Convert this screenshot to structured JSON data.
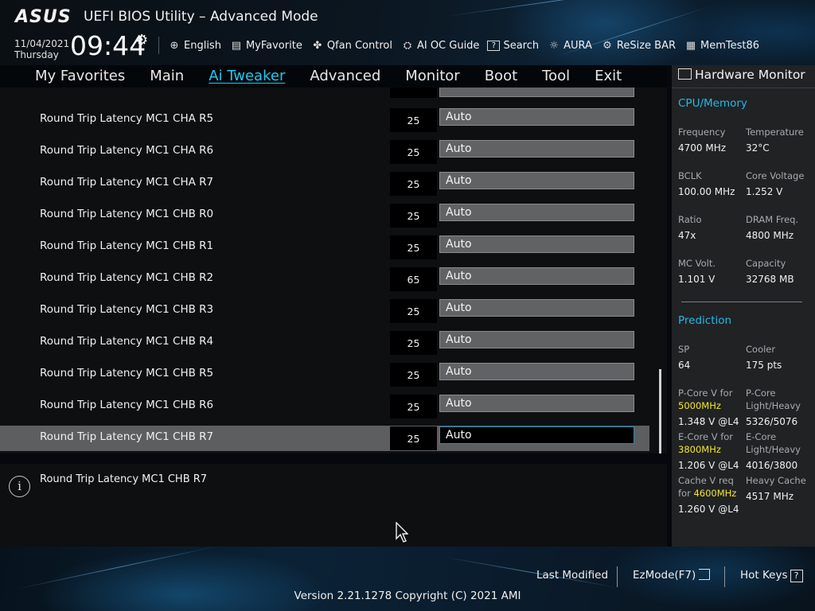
{
  "header": {
    "brand": "ASUS",
    "title": "UEFI BIOS Utility – Advanced Mode",
    "date": "11/04/2021",
    "weekday": "Thursday",
    "time": "09:44"
  },
  "toolbar": [
    {
      "icon": "globe-icon",
      "glyph": "⊕",
      "label": "English"
    },
    {
      "icon": "favorite-icon",
      "glyph": "▤",
      "label": "MyFavorite"
    },
    {
      "icon": "fan-icon",
      "glyph": "✤",
      "label": "Qfan Control"
    },
    {
      "icon": "chip-icon",
      "glyph": "⛭",
      "label": "AI OC Guide"
    },
    {
      "icon": "search-icon",
      "glyph": "?",
      "label": "Search"
    },
    {
      "icon": "aura-icon",
      "glyph": "☼",
      "label": "AURA"
    },
    {
      "icon": "resize-bar-icon",
      "glyph": "⚙",
      "label": "ReSize BAR"
    },
    {
      "icon": "memtest-icon",
      "glyph": "▦",
      "label": "MemTest86"
    }
  ],
  "menu": [
    {
      "label": "My Favorites",
      "active": false
    },
    {
      "label": "Main",
      "active": false
    },
    {
      "label": "Ai Tweaker",
      "active": true
    },
    {
      "label": "Advanced",
      "active": false
    },
    {
      "label": "Monitor",
      "active": false
    },
    {
      "label": "Boot",
      "active": false
    },
    {
      "label": "Tool",
      "active": false
    },
    {
      "label": "Exit",
      "active": false
    }
  ],
  "settings": [
    {
      "label": "Round Trip Latency MC1 CHA R5",
      "value": "25",
      "option": "Auto",
      "selected": false
    },
    {
      "label": "Round Trip Latency MC1 CHA R6",
      "value": "25",
      "option": "Auto",
      "selected": false
    },
    {
      "label": "Round Trip Latency MC1 CHA R7",
      "value": "25",
      "option": "Auto",
      "selected": false
    },
    {
      "label": "Round Trip Latency MC1 CHB R0",
      "value": "25",
      "option": "Auto",
      "selected": false
    },
    {
      "label": "Round Trip Latency MC1 CHB R1",
      "value": "25",
      "option": "Auto",
      "selected": false
    },
    {
      "label": "Round Trip Latency MC1 CHB R2",
      "value": "65",
      "option": "Auto",
      "selected": false
    },
    {
      "label": "Round Trip Latency MC1 CHB R3",
      "value": "25",
      "option": "Auto",
      "selected": false
    },
    {
      "label": "Round Trip Latency MC1 CHB R4",
      "value": "25",
      "option": "Auto",
      "selected": false
    },
    {
      "label": "Round Trip Latency MC1 CHB R5",
      "value": "25",
      "option": "Auto",
      "selected": false
    },
    {
      "label": "Round Trip Latency MC1 CHB R6",
      "value": "25",
      "option": "Auto",
      "selected": false
    },
    {
      "label": "Round Trip Latency MC1 CHB R7",
      "value": "25",
      "option": "Auto",
      "selected": true
    }
  ],
  "help": {
    "text": "Round Trip Latency MC1 CHB R7"
  },
  "hardware_monitor": {
    "title": "Hardware Monitor",
    "cpu_memory": {
      "heading": "CPU/Memory",
      "frequency_label": "Frequency",
      "frequency": "4700 MHz",
      "temperature_label": "Temperature",
      "temperature": "32°C",
      "bclk_label": "BCLK",
      "bclk": "100.00 MHz",
      "core_voltage_label": "Core Voltage",
      "core_voltage": "1.252 V",
      "ratio_label": "Ratio",
      "ratio": "47x",
      "dram_freq_label": "DRAM Freq.",
      "dram_freq": "4800 MHz",
      "mc_volt_label": "MC Volt.",
      "mc_volt": "1.101 V",
      "capacity_label": "Capacity",
      "capacity": "32768 MB"
    },
    "prediction": {
      "heading": "Prediction",
      "sp_label": "SP",
      "sp": "64",
      "cooler_label": "Cooler",
      "cooler": "175 pts",
      "pcore_v_label": "P-Core V for",
      "pcore_v_freq": "5000MHz",
      "pcore_v": "1.348 V @L4",
      "pcore_lh_label1": "P-Core",
      "pcore_lh_label2": "Light/Heavy",
      "pcore_lh": "5326/5076",
      "ecore_v_label": "E-Core V for",
      "ecore_v_freq": "3800MHz",
      "ecore_v": "1.206 V @L4",
      "ecore_lh_label1": "E-Core",
      "ecore_lh_label2": "Light/Heavy",
      "ecore_lh": "4016/3800",
      "cache_v_label1": "Cache V req",
      "cache_v_label2": "for",
      "cache_v_freq": "4600MHz",
      "cache_v": "1.260 V @L4",
      "heavy_cache_label": "Heavy Cache",
      "heavy_cache": "4517 MHz"
    }
  },
  "footer": {
    "last_modified": "Last Modified",
    "ezmode": "EzMode(F7)",
    "hot_keys": "Hot Keys",
    "hot_keys_icon": "?",
    "version": "Version 2.21.1278 Copyright (C) 2021 AMI"
  }
}
